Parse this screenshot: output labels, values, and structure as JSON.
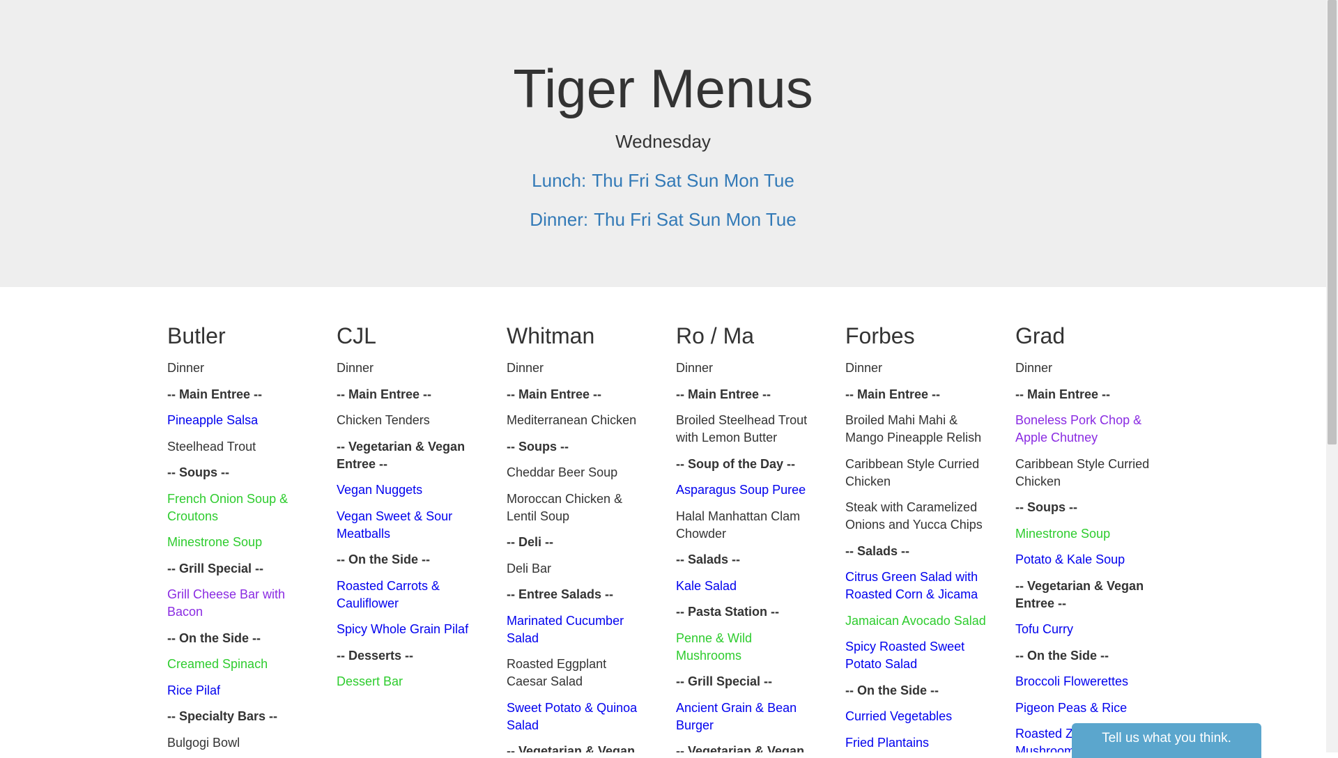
{
  "hero": {
    "title": "Tiger Menus",
    "day": "Wednesday",
    "lunch_label": "Lunch:",
    "dinner_label": "Dinner:",
    "lunch_days": [
      "Thu",
      "Fri",
      "Sat",
      "Sun",
      "Mon",
      "Tue"
    ],
    "dinner_days": [
      "Thu",
      "Fri",
      "Sat",
      "Sun",
      "Mon",
      "Tue"
    ]
  },
  "colors": {
    "default": "#333333",
    "blue": "#0000ee",
    "green": "#2ecc2e",
    "purple": "#8a2be2",
    "link": "#337ab7",
    "hero_bg": "#eeeeee",
    "feedback_bg": "#5ba6cd"
  },
  "halls": [
    {
      "name": "Butler",
      "meal": "Dinner",
      "items": [
        {
          "text": "-- Main Entree --",
          "type": "header"
        },
        {
          "text": "Pineapple Salsa",
          "color": "blue"
        },
        {
          "text": "Steelhead Trout",
          "color": "default"
        },
        {
          "text": "-- Soups --",
          "type": "header"
        },
        {
          "text": "French Onion Soup & Croutons",
          "color": "green"
        },
        {
          "text": "Minestrone Soup",
          "color": "green"
        },
        {
          "text": "-- Grill Special --",
          "type": "header"
        },
        {
          "text": "Grill Cheese Bar with Bacon",
          "color": "purple"
        },
        {
          "text": "-- On the Side --",
          "type": "header"
        },
        {
          "text": "Creamed Spinach",
          "color": "green"
        },
        {
          "text": "Rice Pilaf",
          "color": "blue"
        },
        {
          "text": "-- Specialty Bars --",
          "type": "header"
        },
        {
          "text": "Bulgogi Bowl",
          "color": "default"
        }
      ]
    },
    {
      "name": "CJL",
      "meal": "Dinner",
      "items": [
        {
          "text": "-- Main Entree --",
          "type": "header"
        },
        {
          "text": "Chicken Tenders",
          "color": "default"
        },
        {
          "text": "-- Vegetarian & Vegan Entree --",
          "type": "header"
        },
        {
          "text": "Vegan Nuggets",
          "color": "blue"
        },
        {
          "text": "Vegan Sweet & Sour Meatballs",
          "color": "blue"
        },
        {
          "text": "-- On the Side --",
          "type": "header"
        },
        {
          "text": "Roasted Carrots & Cauliflower",
          "color": "blue"
        },
        {
          "text": "Spicy Whole Grain Pilaf",
          "color": "blue"
        },
        {
          "text": "-- Desserts --",
          "type": "header"
        },
        {
          "text": "Dessert Bar",
          "color": "green"
        }
      ]
    },
    {
      "name": "Whitman",
      "meal": "Dinner",
      "items": [
        {
          "text": "-- Main Entree --",
          "type": "header"
        },
        {
          "text": "Mediterranean Chicken",
          "color": "default"
        },
        {
          "text": "-- Soups --",
          "type": "header"
        },
        {
          "text": "Cheddar Beer Soup",
          "color": "default"
        },
        {
          "text": "Moroccan Chicken & Lentil Soup",
          "color": "default"
        },
        {
          "text": "-- Deli --",
          "type": "header"
        },
        {
          "text": "Deli Bar",
          "color": "default"
        },
        {
          "text": "-- Entree Salads --",
          "type": "header"
        },
        {
          "text": "Marinated Cucumber Salad",
          "color": "blue"
        },
        {
          "text": "Roasted Eggplant Caesar Salad",
          "color": "default"
        },
        {
          "text": "Sweet Potato & Quinoa Salad",
          "color": "blue"
        },
        {
          "text": "-- Vegetarian & Vegan",
          "type": "header"
        }
      ]
    },
    {
      "name": "Ro / Ma",
      "meal": "Dinner",
      "items": [
        {
          "text": "-- Main Entree --",
          "type": "header"
        },
        {
          "text": "Broiled Steelhead Trout with Lemon Butter",
          "color": "default"
        },
        {
          "text": "-- Soup of the Day --",
          "type": "header"
        },
        {
          "text": "Asparagus Soup Puree",
          "color": "blue"
        },
        {
          "text": "Halal Manhattan Clam Chowder",
          "color": "default"
        },
        {
          "text": "-- Salads --",
          "type": "header"
        },
        {
          "text": "Kale Salad",
          "color": "blue"
        },
        {
          "text": "-- Pasta Station --",
          "type": "header"
        },
        {
          "text": "Penne & Wild Mushrooms",
          "color": "green"
        },
        {
          "text": "-- Grill Special --",
          "type": "header"
        },
        {
          "text": "Ancient Grain & Bean Burger",
          "color": "blue"
        },
        {
          "text": "-- Vegetarian & Vegan Entree --",
          "type": "header"
        }
      ]
    },
    {
      "name": "Forbes",
      "meal": "Dinner",
      "items": [
        {
          "text": "-- Main Entree --",
          "type": "header"
        },
        {
          "text": "Broiled Mahi Mahi & Mango Pineapple Relish",
          "color": "default"
        },
        {
          "text": "Caribbean Style Curried Chicken",
          "color": "default"
        },
        {
          "text": "Steak with Caramelized Onions and Yucca Chips",
          "color": "default"
        },
        {
          "text": "-- Salads --",
          "type": "header"
        },
        {
          "text": "Citrus Green Salad with Roasted Corn & Jicama",
          "color": "blue"
        },
        {
          "text": "Jamaican Avocado Salad",
          "color": "green"
        },
        {
          "text": "Spicy Roasted Sweet Potato Salad",
          "color": "blue"
        },
        {
          "text": "-- On the Side --",
          "type": "header"
        },
        {
          "text": "Curried Vegetables",
          "color": "blue"
        },
        {
          "text": "Fried Plantains",
          "color": "blue"
        }
      ]
    },
    {
      "name": "Grad",
      "meal": "Dinner",
      "items": [
        {
          "text": "-- Main Entree --",
          "type": "header"
        },
        {
          "text": "Boneless Pork Chop & Apple Chutney",
          "color": "purple"
        },
        {
          "text": "Caribbean Style Curried Chicken",
          "color": "default"
        },
        {
          "text": "-- Soups --",
          "type": "header"
        },
        {
          "text": "Minestrone Soup",
          "color": "green"
        },
        {
          "text": "Potato & Kale Soup",
          "color": "blue"
        },
        {
          "text": "-- Vegetarian & Vegan Entree --",
          "type": "header"
        },
        {
          "text": "Tofu Curry",
          "color": "blue"
        },
        {
          "text": "-- On the Side --",
          "type": "header"
        },
        {
          "text": "Broccoli Flowerettes",
          "color": "blue"
        },
        {
          "text": "Pigeon Peas & Rice",
          "color": "blue"
        },
        {
          "text": "Roasted Zucchini & Mushrooms",
          "color": "blue"
        }
      ]
    }
  ],
  "feedback": {
    "label": "Tell us what you think."
  }
}
